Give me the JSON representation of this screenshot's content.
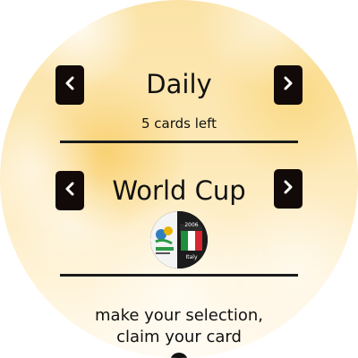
{
  "category": {
    "title": "Daily",
    "status": "5 cards left",
    "prev_icon": "chevron-left-icon",
    "next_icon": "chevron-right-icon"
  },
  "collection": {
    "title": "World Cup",
    "badge_year": "2006",
    "badge_country": "Italy",
    "prev_icon": "chevron-left-icon",
    "next_icon": "chevron-right-icon"
  },
  "instructions": {
    "line1": "make your selection,",
    "line2": "claim your card"
  },
  "colors": {
    "button": "#120a08",
    "divider": "#1a1a1a",
    "text": "#111111",
    "flag_green": "#1e8f3b",
    "flag_white": "#ffffff",
    "flag_red": "#d7262f"
  }
}
